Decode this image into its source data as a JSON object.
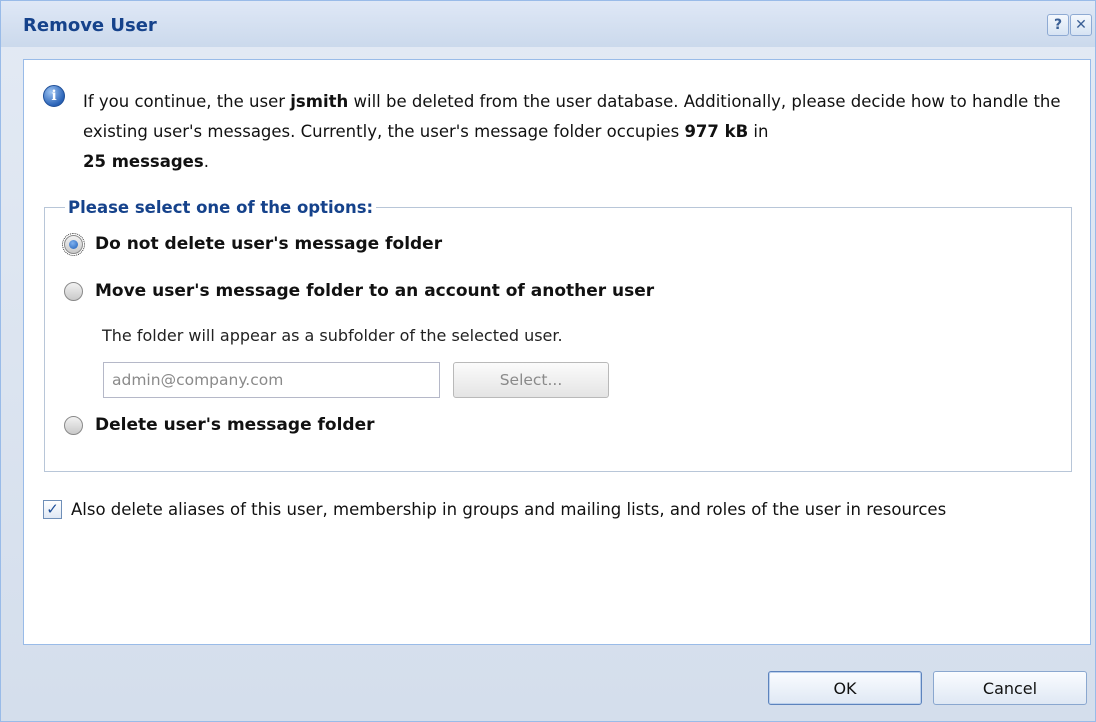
{
  "dialog": {
    "title": "Remove User",
    "help_icon": "?",
    "close_icon": "✕"
  },
  "info": {
    "icon": "info-icon",
    "text_part1": "If you continue, the user ",
    "username": "jsmith",
    "text_part2": " will be deleted from the user database. Additionally, please decide how to handle the existing user's messages. Currently, the user's message folder occupies ",
    "folder_size": "977 kB",
    "text_part3": " in ",
    "message_count": "25 messages",
    "text_part4": "."
  },
  "options": {
    "legend": "Please select one of the options:",
    "items": [
      {
        "label": "Do not delete user's message folder",
        "checked": true
      },
      {
        "label": "Move user's message folder to an account of another user",
        "checked": false
      },
      {
        "label": "Delete user's message folder",
        "checked": false
      }
    ],
    "move_hint": "The folder will appear as a subfolder of the selected user.",
    "user_input_placeholder": "admin@company.com",
    "select_button": "Select..."
  },
  "also_delete": {
    "checked": true,
    "label": "Also delete aliases of this user, membership in groups and mailing lists, and roles of the user in resources"
  },
  "footer": {
    "ok_label": "OK",
    "cancel_label": "Cancel"
  }
}
